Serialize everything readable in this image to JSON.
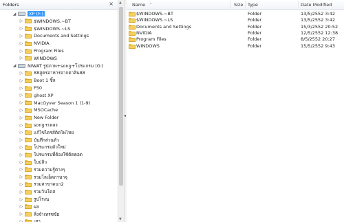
{
  "left_pane": {
    "title": "Folders",
    "close_glyph": "×"
  },
  "tree": {
    "items": [
      {
        "label": "XP (F:)",
        "kind": "drive",
        "level": 0,
        "expanded": true,
        "selected": true
      },
      {
        "label": "$WINDOWS.~BT",
        "kind": "folder",
        "level": 1
      },
      {
        "label": "$WINDOWS.~LS",
        "kind": "folder",
        "level": 1
      },
      {
        "label": "Documents and Settings",
        "kind": "folder",
        "level": 1
      },
      {
        "label": "NVIDIA",
        "kind": "folder",
        "level": 1
      },
      {
        "label": "Program Files",
        "kind": "folder",
        "level": 1
      },
      {
        "label": "WINDOWS",
        "kind": "folder",
        "level": 1
      },
      {
        "label": "NIWAT รูปภาพ+song+โปรแกรม (G:)",
        "kind": "drive",
        "level": 0,
        "expanded": true
      },
      {
        "label": "88สูตรอาหารจากตาลิน88",
        "kind": "folder",
        "level": 1
      },
      {
        "label": "Boot 1 ชิ้ล",
        "kind": "folder",
        "level": 1
      },
      {
        "label": "F50",
        "kind": "folder",
        "level": 1
      },
      {
        "label": "ghost XP",
        "kind": "folder",
        "level": 1
      },
      {
        "label": "MacGyver Season 1 (1-9)",
        "kind": "folder",
        "level": 1
      },
      {
        "label": "MSOCache",
        "kind": "folder",
        "level": 1
      },
      {
        "label": "New Folder",
        "kind": "folder",
        "level": 1
      },
      {
        "label": "song+เพลง",
        "kind": "folder",
        "level": 1
      },
      {
        "label": "แก้ไขไดรส์ติดไพไทย",
        "kind": "folder",
        "level": 1
      },
      {
        "label": "บันทึกส่วนตัว",
        "kind": "folder",
        "level": 1
      },
      {
        "label": "โปรแกรมตัวใหม่",
        "kind": "folder",
        "level": 1
      },
      {
        "label": "โปรแกรมที่ต้องใช้ติดตอด",
        "kind": "folder",
        "level": 1
      },
      {
        "label": "ใบปลิว",
        "kind": "folder",
        "level": 1
      },
      {
        "label": "รวมความรู้ต่างๆ",
        "kind": "folder",
        "level": 1
      },
      {
        "label": "รวมโลเอ็ดภาษาจุ",
        "kind": "folder",
        "level": 1
      },
      {
        "label": "รวมสาขาคนา2",
        "kind": "folder",
        "level": 1
      },
      {
        "label": "รวมวินโดส",
        "kind": "folder",
        "level": 1
      },
      {
        "label": "รูปโรงน",
        "kind": "folder",
        "level": 1
      },
      {
        "label": "ผล",
        "kind": "folder",
        "level": 1
      },
      {
        "label": "สิ่งจำเทรซขัย",
        "kind": "folder",
        "level": 1
      },
      {
        "label": "เสา",
        "kind": "folder",
        "level": 1
      }
    ]
  },
  "list": {
    "columns": {
      "name": "Name",
      "sort_glyph": "^",
      "size": "Size",
      "type": "Type",
      "date": "Date Modified"
    },
    "rows": [
      {
        "name": "$WINDOWS.~BT",
        "type": "Folder",
        "date": "13/5/2552 3:42"
      },
      {
        "name": "$WINDOWS.~LS",
        "type": "Folder",
        "date": "13/5/2552 3:42"
      },
      {
        "name": "Documents and Settings",
        "type": "Folder",
        "date": "15/3/2552 20:52"
      },
      {
        "name": "NVIDIA",
        "type": "Folder",
        "date": "12/5/2552 12:38"
      },
      {
        "name": "Program Files",
        "type": "Folder",
        "date": "8/5/2552 20:27"
      },
      {
        "name": "WINDOWS",
        "type": "Folder",
        "date": "15/5/2552 9:43"
      }
    ]
  },
  "colors": {
    "selection": "#3399ff",
    "folder": "#f4cf5a"
  }
}
